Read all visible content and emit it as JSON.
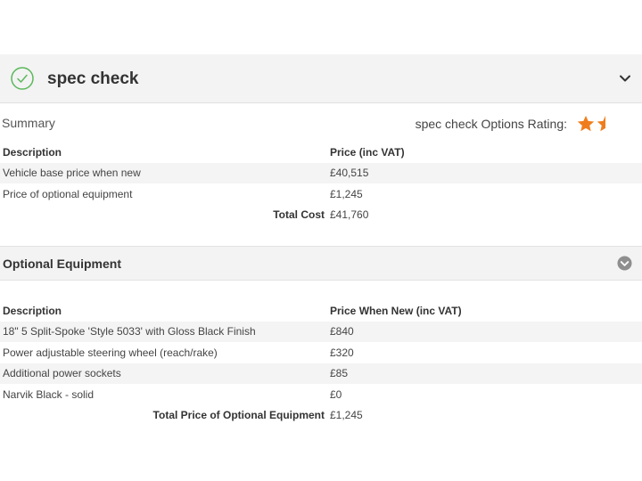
{
  "header": {
    "title": "spec check"
  },
  "summary": {
    "label": "Summary",
    "rating_label": "spec check Options Rating:",
    "rating_value": 1.5,
    "rating_max": 2,
    "accent_color": "#f07d1c",
    "columns": [
      "Description",
      "Price (inc VAT)"
    ],
    "rows": [
      [
        "Vehicle base price when new",
        "£40,515"
      ],
      [
        "Price of optional equipment",
        "£1,245"
      ]
    ],
    "total_label": "Total Cost",
    "total_value": "£41,760"
  },
  "optional": {
    "title": "Optional Equipment",
    "columns": [
      "Description",
      "Price When New (inc VAT)"
    ],
    "rows": [
      [
        "18\" 5 Split-Spoke 'Style 5033' with Gloss Black Finish",
        "£840"
      ],
      [
        "Power adjustable steering wheel (reach/rake)",
        "£320"
      ],
      [
        "Additional power sockets",
        "£85"
      ],
      [
        "Narvik Black - solid",
        "£0"
      ]
    ],
    "total_label": "Total Price of Optional Equipment",
    "total_value": "£1,245"
  }
}
